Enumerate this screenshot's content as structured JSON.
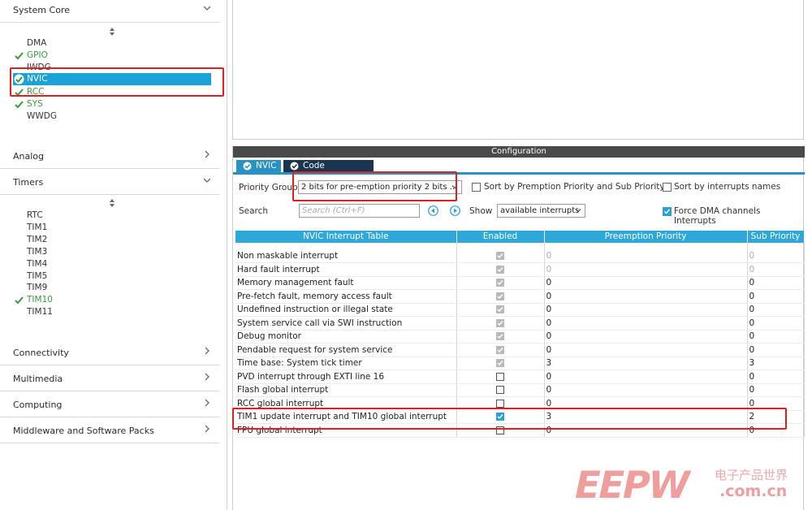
{
  "sidebar": {
    "system_core": {
      "label": "System Core",
      "items": [
        {
          "label": "DMA",
          "enabled": false
        },
        {
          "label": "GPIO",
          "enabled": true
        },
        {
          "label": "IWDG",
          "enabled": false
        },
        {
          "label": "NVIC",
          "enabled": true,
          "selected": true
        },
        {
          "label": "RCC",
          "enabled": true
        },
        {
          "label": "SYS",
          "enabled": true
        },
        {
          "label": "WWDG",
          "enabled": false
        }
      ]
    },
    "analog": {
      "label": "Analog"
    },
    "timers": {
      "label": "Timers",
      "items": [
        {
          "label": "RTC",
          "enabled": false
        },
        {
          "label": "TIM1",
          "enabled": false
        },
        {
          "label": "TIM2",
          "enabled": false
        },
        {
          "label": "TIM3",
          "enabled": false
        },
        {
          "label": "TIM4",
          "enabled": false
        },
        {
          "label": "TIM5",
          "enabled": false
        },
        {
          "label": "TIM9",
          "enabled": false
        },
        {
          "label": "TIM10",
          "enabled": true
        },
        {
          "label": "TIM11",
          "enabled": false
        }
      ]
    },
    "connectivity": {
      "label": "Connectivity"
    },
    "multimedia": {
      "label": "Multimedia"
    },
    "computing": {
      "label": "Computing"
    },
    "middleware": {
      "label": "Middleware and Software Packs"
    }
  },
  "config": {
    "title": "Configuration",
    "tabs": [
      {
        "label": "NVIC",
        "active": true
      },
      {
        "label": "Code generation",
        "active": false
      }
    ],
    "priority_group_label": "Priority Group",
    "priority_group_value": "2 bits for pre-emption priority 2 bits ...",
    "sort_by_preemption_label": "Sort by Premption Priority and Sub Priority",
    "sort_by_preemption_checked": false,
    "sort_by_names_label": "Sort by interrupts names",
    "sort_by_names_checked": false,
    "search_label": "Search",
    "search_placeholder": "Search (Ctrl+F)",
    "show_label": "Show",
    "show_value": "available interrupts",
    "force_dma_label": "Force DMA channels Interrupts",
    "force_dma_checked": true
  },
  "table": {
    "headers": [
      "NVIC Interrupt Table",
      "Enabled",
      "Preemption Priority",
      "Sub Priority"
    ],
    "rows": [
      {
        "name": "Non maskable interrupt",
        "enabled": "locked",
        "preemption": "0",
        "sub": "0",
        "editable": false
      },
      {
        "name": "Hard fault interrupt",
        "enabled": "locked",
        "preemption": "0",
        "sub": "0",
        "editable": false
      },
      {
        "name": "Memory management fault",
        "enabled": "locked",
        "preemption": "0",
        "sub": "0",
        "editable": true
      },
      {
        "name": "Pre-fetch fault, memory access fault",
        "enabled": "locked",
        "preemption": "0",
        "sub": "0",
        "editable": true
      },
      {
        "name": "Undefined instruction or illegal state",
        "enabled": "locked",
        "preemption": "0",
        "sub": "0",
        "editable": true
      },
      {
        "name": "System service call via SWI instruction",
        "enabled": "locked",
        "preemption": "0",
        "sub": "0",
        "editable": true
      },
      {
        "name": "Debug monitor",
        "enabled": "locked",
        "preemption": "0",
        "sub": "0",
        "editable": true
      },
      {
        "name": "Pendable request for system service",
        "enabled": "locked",
        "preemption": "0",
        "sub": "0",
        "editable": true
      },
      {
        "name": "Time base: System tick timer",
        "enabled": "locked",
        "preemption": "3",
        "sub": "3",
        "editable": true
      },
      {
        "name": "PVD interrupt through EXTI line 16",
        "enabled": "off",
        "preemption": "0",
        "sub": "0",
        "editable": true
      },
      {
        "name": "Flash global interrupt",
        "enabled": "off",
        "preemption": "0",
        "sub": "0",
        "editable": true
      },
      {
        "name": "RCC global interrupt",
        "enabled": "off",
        "preemption": "0",
        "sub": "0",
        "editable": true
      },
      {
        "name": "TIM1 update interrupt and TIM10 global interrupt",
        "enabled": "on",
        "preemption": "3",
        "sub": "2",
        "editable": true
      },
      {
        "name": "FPU global interrupt",
        "enabled": "off",
        "preemption": "0",
        "sub": "0",
        "editable": true
      }
    ]
  },
  "watermark": {
    "logo": "EEPW",
    "cn_text": "电子产品世界",
    "url": ".com.cn"
  },
  "colors": {
    "accent": "#2ea7d9",
    "selection": "#1aa3d9",
    "enabled_green": "#3a9a3a",
    "highlight_red": "#e02020"
  }
}
